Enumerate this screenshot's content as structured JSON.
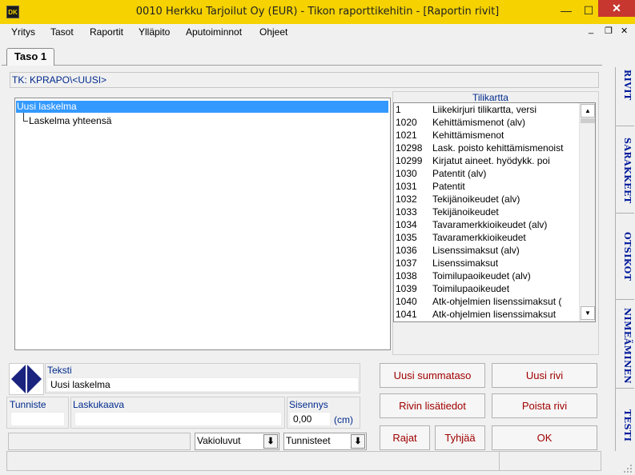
{
  "window": {
    "title": "0010  Herkku Tarjoilut Oy (EUR) - Tikon raporttikehitin - [Raportin rivit]",
    "icon_label": "DK",
    "minimize": "—",
    "maximize": "☐",
    "close": "✕",
    "mdi_minimize": "_",
    "mdi_restore": "❐",
    "mdi_close": "✕"
  },
  "menu": [
    "Yritys",
    "Tasot",
    "Raportit",
    "Ylläpito",
    "Aputoiminnot",
    "Ohjeet"
  ],
  "tab": {
    "label": "Taso 1"
  },
  "path": "TK: KPRAPO\\<UUSI>",
  "tree": {
    "selected": "Uusi laskelma",
    "child": "Laskelma yhteensä"
  },
  "accounts": {
    "title": "Tilikartta",
    "rows": [
      {
        "num": "1",
        "name": "Liikekirjuri tilikartta, versi"
      },
      {
        "num": "1020",
        "name": "Kehittämismenot (alv)"
      },
      {
        "num": "1021",
        "name": "Kehittämismenot"
      },
      {
        "num": "10298",
        "name": "Lask. poisto kehittämismenoist"
      },
      {
        "num": "10299",
        "name": "Kirjatut aineet. hyödykk. poi"
      },
      {
        "num": "1030",
        "name": "Patentit (alv)"
      },
      {
        "num": "1031",
        "name": "Patentit"
      },
      {
        "num": "1032",
        "name": "Tekijänoikeudet (alv)"
      },
      {
        "num": "1033",
        "name": "Tekijänoikeudet"
      },
      {
        "num": "1034",
        "name": "Tavaramerkkioikeudet (alv)"
      },
      {
        "num": "1035",
        "name": "Tavaramerkkioikeudet"
      },
      {
        "num": "1036",
        "name": "Lisenssimaksut (alv)"
      },
      {
        "num": "1037",
        "name": "Lisenssimaksut"
      },
      {
        "num": "1038",
        "name": "Toimilupaoikeudet (alv)"
      },
      {
        "num": "1039",
        "name": "Toimilupaoikeudet"
      },
      {
        "num": "1040",
        "name": "Atk-ohjelmien lisenssimaksut ("
      },
      {
        "num": "1041",
        "name": "Atk-ohjelmien lisenssimaksut"
      }
    ],
    "scroll_up": "▲",
    "scroll_down": "▼"
  },
  "form": {
    "teksti_label": "Teksti",
    "teksti_value": "Uusi laskelma",
    "tunniste_label": "Tunniste",
    "tunniste_value": "",
    "laskukaava_label": "Laskukaava",
    "laskukaava_value": "",
    "sisennys_label": "Sisennys",
    "sisennys_value": "0,00",
    "sisennys_unit": "(cm)",
    "status_field": "",
    "vakioluvut": "Vakioluvut",
    "tunnisteet": "Tunnisteet",
    "dropdown_arrow": "⬇"
  },
  "buttons": {
    "uusi_summataso": "Uusi summataso",
    "uusi_rivi": "Uusi rivi",
    "rivin_lisatiedot": "Rivin lisätiedot",
    "poista_rivi": "Poista rivi",
    "rajat": "Rajat",
    "tyhjaa": "Tyhjää",
    "ok": "OK"
  },
  "side_tabs": [
    "RIVIT",
    "SARAKKEET",
    "OTSIKOT",
    "NIMEÄMINEN",
    "TESTI"
  ],
  "colors": {
    "titlebar": "#f5d200",
    "selection": "#3399ff",
    "label_blue": "#002a8c",
    "button_text": "#a00000",
    "side_tab_text": "#00199a"
  }
}
